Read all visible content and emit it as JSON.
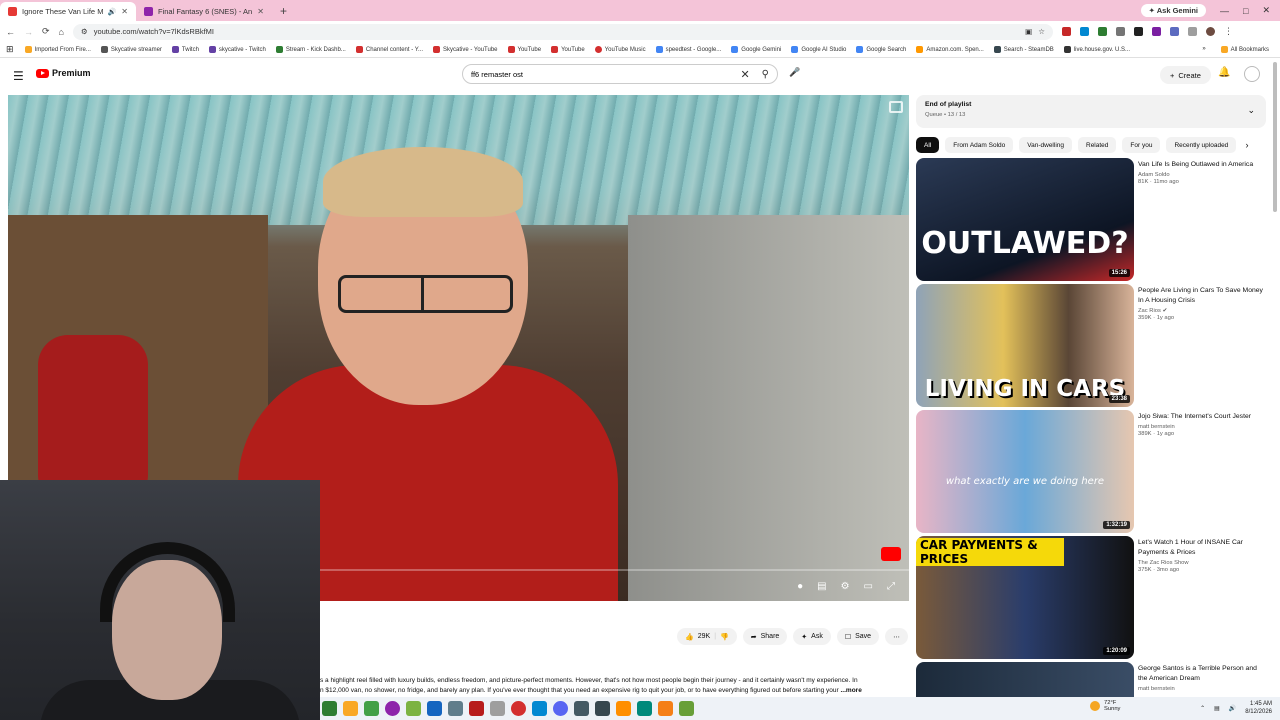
{
  "browser": {
    "tabs": [
      {
        "title": "Ignore These Van Life Myth",
        "active": true
      },
      {
        "title": "Final Fantasy 6 (SNES) - Angry V",
        "active": false
      }
    ],
    "new_tab": "+",
    "ask_gemini": "Ask Gemini",
    "url": "youtube.com/watch?v=7lKdsRBkfMI",
    "bookmarks": [
      "Imported From Fire...",
      "Skycative streamer",
      "Twitch",
      "skycative - Twitch",
      "Stream - Kick Dashb...",
      "Channel content - Y...",
      "Skycative - YouTube",
      "YouTube",
      "YouTube",
      "YouTube Music",
      "speedtest - Google...",
      "Google Gemini",
      "Google AI Studio",
      "Google Search",
      "Amazon.com. Spen...",
      "Search - SteamDB",
      "live.house.gov. U.S..."
    ],
    "all_bookmarks": "All Bookmarks"
  },
  "youtube": {
    "logo": "Premium",
    "search_value": "ff6 remaster ost",
    "create": "Create"
  },
  "actions": {
    "likes": "29K",
    "share": "Share",
    "ask": "Ask",
    "save": "Save"
  },
  "description": {
    "line1": "s a highlight reel filled with luxury builds, endless freedom, and picture-perfect moments. However, that's not how most people begin their journey - and it certainly wasn't my experience. In",
    "line2": "n $12,000 van, no shower, no fridge, and barely any plan. If you've ever thought that you need an expensive rig to quit your job, or to have everything figured out before starting your",
    "more": "...more"
  },
  "queue": {
    "title": "End of playlist",
    "subtitle": "Queue • 13 / 13"
  },
  "chips": [
    "All",
    "From Adam Soldo",
    "Van-dwelling",
    "Related",
    "For you",
    "Recently uploaded",
    "Wa"
  ],
  "videos": [
    {
      "title": "Van Life Is Being Outlawed in America",
      "channel": "Adam Soldo",
      "stats": "81K  ·  11mo ago",
      "duration": "15:26",
      "overlay": "OUTLAWED?"
    },
    {
      "title": "People Are Living in Cars To Save Money In A Housing Crisis",
      "channel": "Zac Rios",
      "stats": "359K  ·  1y ago",
      "duration": "23:38",
      "overlay": "LIVING IN CARS"
    },
    {
      "title": "Jojo Siwa: The Internet's Court Jester",
      "channel": "matt bernstein",
      "stats": "389K  ·  1y ago",
      "duration": "1:32:19",
      "overlay": "what exactly are we doing here"
    },
    {
      "title": "Let's Watch 1 Hour of INSANE Car Payments & Prices",
      "channel": "The Zac Rios Show",
      "stats": "375K  ·  3mo ago",
      "duration": "1:20:09",
      "overlay": "CAR PAYMENTS & PRICES"
    },
    {
      "title": "George Santos is a Terrible Person and the American Dream",
      "channel": "matt bernstein",
      "stats": "",
      "duration": "",
      "overlay": ""
    }
  ],
  "taskbar": {
    "temp": "72°F",
    "cond": "Sunny",
    "time": "1:45 AM",
    "date": "8/12/2026"
  },
  "colors": {
    "yt_red": "#ff0000",
    "tab_bar": "#f4c4d8"
  }
}
